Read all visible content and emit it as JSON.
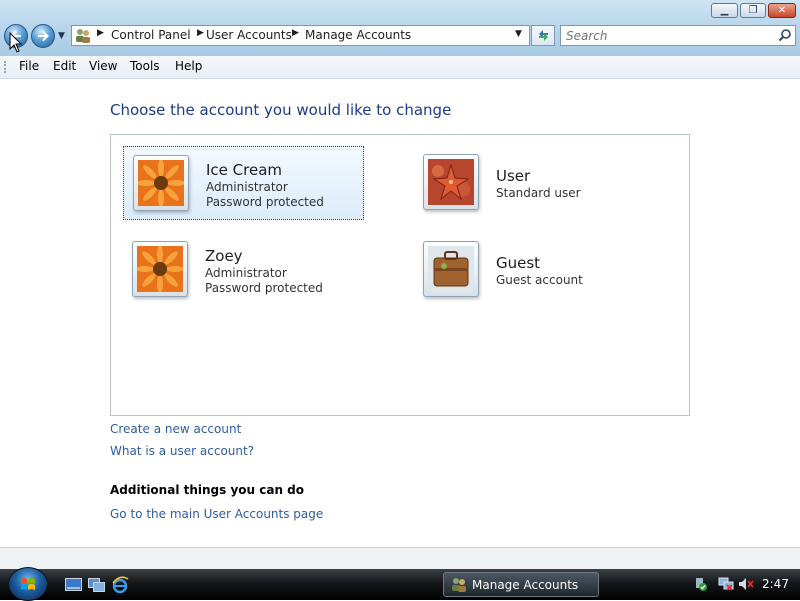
{
  "address_bar": {
    "breadcrumb": [
      "Control Panel",
      "User Accounts",
      "Manage Accounts"
    ]
  },
  "search": {
    "placeholder": "Search"
  },
  "menu": {
    "items": [
      "File",
      "Edit",
      "View",
      "Tools",
      "Help"
    ]
  },
  "main": {
    "heading": "Choose the account you would like to change",
    "accounts": [
      {
        "name": "Ice Cream",
        "lines": [
          "Administrator",
          "Password protected"
        ],
        "selected": true,
        "picture": "orange-flower"
      },
      {
        "name": "User",
        "lines": [
          "Standard user"
        ],
        "selected": false,
        "picture": "starfish"
      },
      {
        "name": "Zoey",
        "lines": [
          "Administrator",
          "Password protected"
        ],
        "selected": false,
        "picture": "orange-flower"
      },
      {
        "name": "Guest",
        "lines": [
          "Guest account"
        ],
        "selected": false,
        "picture": "briefcase"
      }
    ],
    "links": [
      "Create a new account",
      "What is a user account?"
    ],
    "additional_heading": "Additional things you can do",
    "additional_links": [
      "Go to the main User Accounts page"
    ]
  },
  "taskbar": {
    "window_label": "Manage Accounts",
    "clock": "2:47"
  },
  "colors": {
    "link": "#2e5d9f",
    "heading": "#1e3a8a",
    "taskbar": "#14171a"
  }
}
